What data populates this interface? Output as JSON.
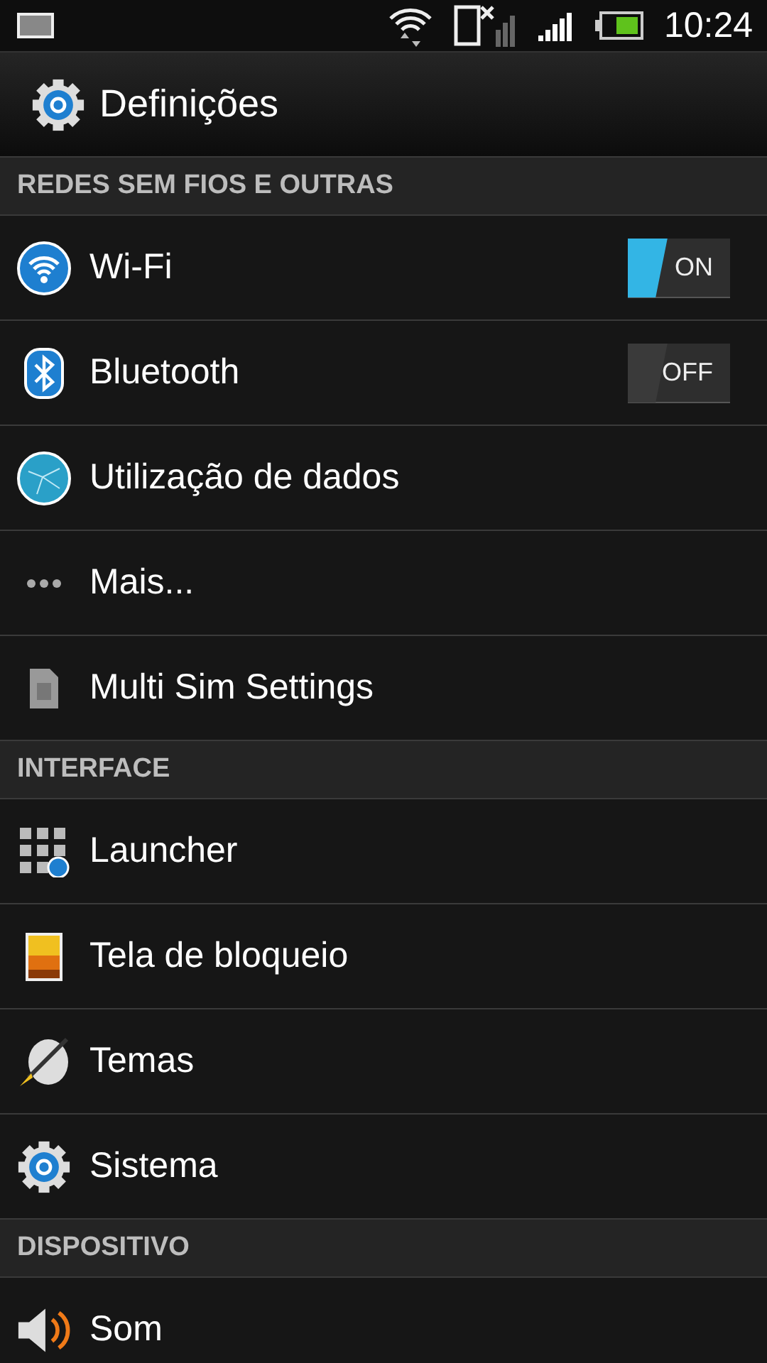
{
  "status_bar": {
    "time": "10:24"
  },
  "title_bar": {
    "title": "Definições"
  },
  "sections": [
    {
      "title": "REDES SEM FIOS E OUTRAS",
      "items": [
        {
          "kind": "wifi",
          "label": "Wi-Fi",
          "toggle": {
            "label": "ON",
            "on": true
          }
        },
        {
          "kind": "bluetooth",
          "label": "Bluetooth",
          "toggle": {
            "label": "OFF",
            "on": false
          }
        },
        {
          "kind": "globe",
          "label": "Utilização de dados"
        },
        {
          "kind": "dots",
          "label": "Mais..."
        },
        {
          "kind": "sim",
          "label": "Multi Sim Settings"
        }
      ]
    },
    {
      "title": "INTERFACE",
      "items": [
        {
          "kind": "grid",
          "label": "Launcher"
        },
        {
          "kind": "lockscreen",
          "label": "Tela de bloqueio"
        },
        {
          "kind": "palette",
          "label": "Temas"
        },
        {
          "kind": "gear",
          "label": "Sistema"
        }
      ]
    },
    {
      "title": "DISPOSITIVO",
      "items": [
        {
          "kind": "speaker",
          "label": "Som"
        }
      ]
    }
  ]
}
